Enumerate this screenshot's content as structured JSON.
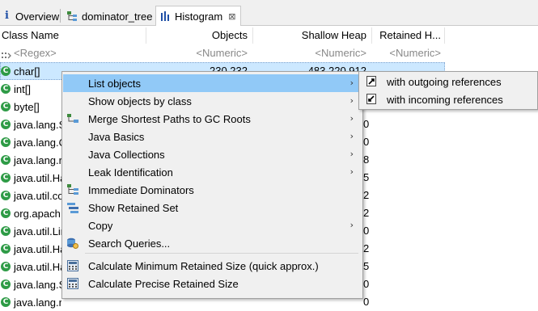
{
  "tabs": [
    {
      "label": "Overview",
      "icon": "info-icon"
    },
    {
      "label": "dominator_tree",
      "icon": "tree-icon"
    },
    {
      "label": "Histogram",
      "icon": "histogram-icon",
      "active": true,
      "close": "⊠"
    }
  ],
  "columns": {
    "class_name": "Class Name",
    "objects": "Objects",
    "shallow_heap": "Shallow Heap",
    "retained_heap": "Retained H..."
  },
  "filters": {
    "regex": "<Regex>",
    "numeric1": "<Numeric>",
    "numeric2": "<Numeric>",
    "numeric3": "<Numeric>"
  },
  "rows": [
    {
      "name": "char[]",
      "objects": "230,232",
      "shallow": "483,220,912",
      "trail": ""
    },
    {
      "name": "int[]",
      "trail": ""
    },
    {
      "name": "byte[]",
      "trail": ""
    },
    {
      "name": "java.lang.S",
      "trail": "0"
    },
    {
      "name": "java.lang.O",
      "trail": "0"
    },
    {
      "name": "java.lang.re",
      "trail": "8"
    },
    {
      "name": "java.util.Ha",
      "trail": "5"
    },
    {
      "name": "java.util.co",
      "trail": "2"
    },
    {
      "name": "org.apach",
      "trail": "2"
    },
    {
      "name": "java.util.Lin",
      "trail": "0"
    },
    {
      "name": "java.util.Ha",
      "trail": "2"
    },
    {
      "name": "java.util.Ha",
      "trail": "5"
    },
    {
      "name": "java.lang.S",
      "trail": "0"
    },
    {
      "name": "java.lang.re",
      "trail": "0"
    }
  ],
  "context_menu": {
    "items": [
      {
        "label": "List objects",
        "submenu": true,
        "highlighted": true,
        "icon": ""
      },
      {
        "label": "Show objects by class",
        "submenu": true,
        "icon": ""
      },
      {
        "label": "Merge Shortest Paths to GC Roots",
        "submenu": true,
        "icon": "merge-paths-icon"
      },
      {
        "label": "Java Basics",
        "submenu": true,
        "icon": ""
      },
      {
        "label": "Java Collections",
        "submenu": true,
        "icon": ""
      },
      {
        "label": "Leak Identification",
        "submenu": true,
        "icon": ""
      },
      {
        "label": "Immediate Dominators",
        "submenu": false,
        "icon": "dominators-icon"
      },
      {
        "label": "Show Retained Set",
        "submenu": false,
        "icon": "retained-set-icon"
      },
      {
        "label": "Copy",
        "submenu": true,
        "icon": ""
      },
      {
        "label": "Search Queries...",
        "submenu": false,
        "icon": "search-queries-icon"
      },
      {
        "label": "Calculate Minimum Retained Size (quick approx.)",
        "submenu": false,
        "icon": "calculator-icon"
      },
      {
        "label": "Calculate Precise Retained Size",
        "submenu": false,
        "icon": "calculator-icon"
      }
    ],
    "submenu_arrow": "›"
  },
  "submenu": {
    "items": [
      {
        "label": "with outgoing references",
        "icon": "outgoing-references-icon"
      },
      {
        "label": "with incoming references",
        "icon": "incoming-references-icon"
      }
    ]
  },
  "colors": {
    "highlight": "#91c9f7",
    "class_icon": "#2e9b46",
    "menu_bg": "#f0f0f0"
  }
}
